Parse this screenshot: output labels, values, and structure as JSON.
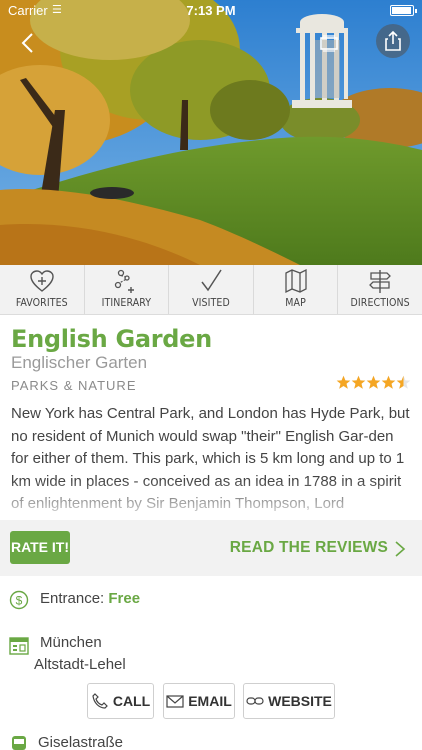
{
  "status_bar": {
    "carrier": "Carrier",
    "time": "7:13 PM",
    "battery_level": 1.0
  },
  "hero": {
    "image_alt": "Monopteros temple in park with autumn trees"
  },
  "toolbar": {
    "items": [
      {
        "label": "FAVORITES",
        "icon": "heart-plus-icon"
      },
      {
        "label": "ITINERARY",
        "icon": "route-icon"
      },
      {
        "label": "VISITED",
        "icon": "checkmark-icon"
      },
      {
        "label": "MAP",
        "icon": "map-icon"
      },
      {
        "label": "DIRECTIONS",
        "icon": "signpost-icon"
      }
    ]
  },
  "place": {
    "name": "English Garden",
    "local_name": "Englischer Garten",
    "category": "PARKS & NATURE",
    "rating": 4.5,
    "rating_max": 5,
    "description": "New York has Central Park, and London has Hyde Park, but no resident of Munich would swap \"their\" English Gar-den for either of them. This park, which is 5 km long and up to 1 km wide in places - conceived as an idea in 1788 in a spirit of enlightenment by Sir Benjamin Thompson, Lord"
  },
  "rate_bar": {
    "rate_label": "RATE IT!",
    "reviews_label": "READ THE REVIEWS"
  },
  "info": {
    "entrance_label": "Entrance: ",
    "entrance_value": "Free",
    "city": "München",
    "district": "Altstadt-Lehel",
    "call_label": "CALL",
    "email_label": "EMAIL",
    "website_label": "WEBSITE",
    "transit_stop": "Giselastraße"
  },
  "colors": {
    "accent": "#6aa844",
    "star": "#f5a623",
    "toolbar_bg": "#f2f2f2"
  }
}
